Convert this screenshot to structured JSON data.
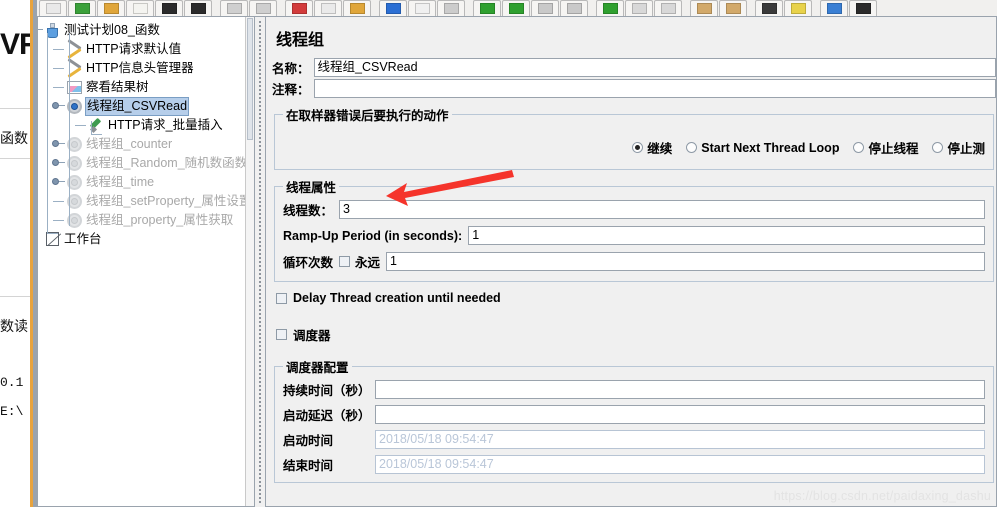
{
  "toolbar": {
    "buttons": [
      {
        "name": "new",
        "glyph": "▭"
      },
      {
        "name": "templates",
        "glyph": "▰"
      },
      {
        "name": "open",
        "glyph": "▬"
      },
      {
        "name": "close",
        "glyph": "▯"
      },
      {
        "name": "save",
        "glyph": "▮"
      },
      {
        "name": "save-as",
        "glyph": "▨"
      },
      {
        "name": "undo",
        "glyph": "↩"
      },
      {
        "name": "redo",
        "glyph": "↪"
      },
      {
        "name": "cut",
        "glyph": "✂"
      },
      {
        "name": "copy",
        "glyph": "❐"
      },
      {
        "name": "paste",
        "glyph": "▣"
      },
      {
        "name": "expand-all",
        "glyph": "⊞"
      },
      {
        "name": "collapse-all",
        "glyph": "⊟"
      },
      {
        "name": "toggle",
        "glyph": "◫"
      },
      {
        "name": "start",
        "glyph": "▶"
      },
      {
        "name": "start-no-pause",
        "glyph": "▷"
      },
      {
        "name": "stop",
        "glyph": "◼"
      },
      {
        "name": "shutdown",
        "glyph": "◻"
      },
      {
        "name": "start-remote",
        "glyph": "▶"
      },
      {
        "name": "stop-remote",
        "glyph": "◼"
      },
      {
        "name": "shutdown-remote",
        "glyph": "◻"
      },
      {
        "name": "clear",
        "glyph": "▤"
      },
      {
        "name": "clear-all",
        "glyph": "▥"
      },
      {
        "name": "search",
        "glyph": "◉"
      },
      {
        "name": "reset-search",
        "glyph": "✦"
      },
      {
        "name": "function-helper",
        "glyph": "▤"
      },
      {
        "name": "help",
        "glyph": "▮"
      }
    ]
  },
  "tree": {
    "nodes": [
      {
        "label": "测试计划08_函数",
        "icon": "flask-icon",
        "depth": 0,
        "state": "normal",
        "selected": false
      },
      {
        "label": "HTTP请求默认值",
        "icon": "tools-icon",
        "depth": 1,
        "state": "normal",
        "selected": false
      },
      {
        "label": "HTTP信息头管理器",
        "icon": "tools-icon",
        "depth": 1,
        "state": "normal",
        "selected": false
      },
      {
        "label": "察看结果树",
        "icon": "chart-icon",
        "depth": 1,
        "state": "normal",
        "selected": false
      },
      {
        "label": "线程组_CSVRead",
        "icon": "gear-icon",
        "depth": 1,
        "state": "normal",
        "selected": true
      },
      {
        "label": "HTTP请求_批量插入",
        "icon": "pen-icon",
        "depth": 2,
        "state": "normal",
        "selected": false
      },
      {
        "label": "线程组_counter",
        "icon": "gear-icon",
        "depth": 1,
        "state": "disabled",
        "selected": false
      },
      {
        "label": "线程组_Random_随机数函数",
        "icon": "gear-icon",
        "depth": 1,
        "state": "disabled",
        "selected": false
      },
      {
        "label": "线程组_time",
        "icon": "gear-icon",
        "depth": 1,
        "state": "disabled",
        "selected": false
      },
      {
        "label": "线程组_setProperty_属性设置",
        "icon": "gear-icon",
        "depth": 1,
        "state": "disabled",
        "selected": false
      },
      {
        "label": "线程组_property_属性获取",
        "icon": "gear-icon",
        "depth": 1,
        "state": "disabled",
        "selected": false
      },
      {
        "label": "工作台",
        "icon": "bench-icon",
        "depth": 0,
        "state": "normal",
        "selected": false
      }
    ]
  },
  "panel": {
    "title": "线程组",
    "name_label": "名称：",
    "name_value": "线程组_CSVRead",
    "comment_label": "注释：",
    "comment_value": "",
    "error_action": {
      "legend": "在取样器错误后要执行的动作",
      "options": [
        {
          "label": "继续",
          "selected": true
        },
        {
          "label": "Start Next Thread Loop",
          "selected": false
        },
        {
          "label": "停止线程",
          "selected": false
        },
        {
          "label": "停止测",
          "selected": false
        }
      ]
    },
    "thread_properties": {
      "legend": "线程属性",
      "threads_label": "线程数：",
      "threads_value": "3",
      "rampup_label": "Ramp-Up Period (in seconds):",
      "rampup_value": "1",
      "loop_label": "循环次数",
      "forever_label": "永远",
      "forever_checked": false,
      "loop_value": "1"
    },
    "delay_creation": {
      "label": "Delay Thread creation until needed",
      "checked": false
    },
    "scheduler_toggle": {
      "label": "调度器",
      "checked": false
    },
    "scheduler": {
      "legend": "调度器配置",
      "duration_label": "持续时间（秒）",
      "duration_value": "",
      "delay_label": "启动延迟（秒）",
      "delay_value": "",
      "start_time_label": "启动时间",
      "start_time_value": "2018/05/18 09:54:47",
      "end_time_label": "结束时间",
      "end_time_value": "2018/05/18 09:54:47"
    }
  },
  "background_window": {
    "line1": "VR",
    "line2": "函数",
    "line3": "数读",
    "line4": "0.1",
    "line5": "E:\\"
  },
  "annotation": {
    "arrow_color": "#f5342b"
  },
  "watermark": "https://blog.csdn.net/paidaxing_dashu"
}
